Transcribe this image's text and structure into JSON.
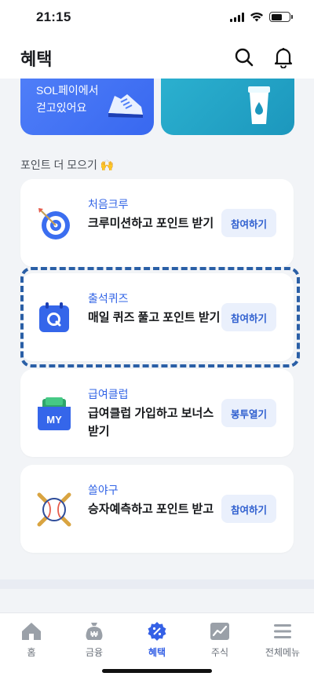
{
  "status": {
    "time": "21:15"
  },
  "header": {
    "title": "혜택"
  },
  "banners": {
    "left_text": "SOL페이에서\n걷고있어요"
  },
  "section": {
    "title": "포인트 더 모으기 🙌"
  },
  "cards": [
    {
      "category": "처음크루",
      "title": "크루미션하고 포인트 받기",
      "button": "참여하기",
      "icon": "target-icon"
    },
    {
      "category": "출석퀴즈",
      "title": "매일 퀴즈 풀고 포인트 받기",
      "button": "참여하기",
      "icon": "quiz-calendar-icon"
    },
    {
      "category": "급여클럽",
      "title": "급여클럽 가입하고 보너스 받기",
      "button": "봉투열기",
      "icon": "wallet-icon"
    },
    {
      "category": "쏠야구",
      "title": "승자예측하고 포인트 받고",
      "button": "참여하기",
      "icon": "baseball-icon"
    }
  ],
  "tabs": [
    {
      "label": "홈",
      "icon": "home-icon"
    },
    {
      "label": "금융",
      "icon": "money-bag-icon"
    },
    {
      "label": "혜택",
      "icon": "benefit-icon",
      "active": true
    },
    {
      "label": "주식",
      "icon": "stock-chart-icon"
    },
    {
      "label": "전체메뉴",
      "icon": "menu-icon"
    }
  ],
  "colors": {
    "accent": "#3561e6",
    "highlight_border": "#2a5fa6"
  }
}
